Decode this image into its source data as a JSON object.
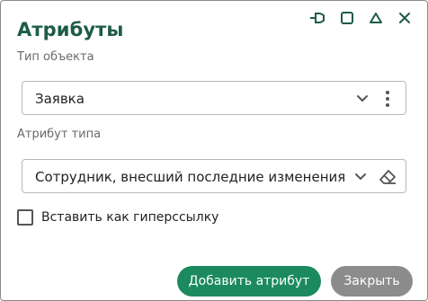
{
  "dialog": {
    "title": "Атрибуты",
    "controls": [
      "pin-icon",
      "maximize-icon",
      "collapse-icon",
      "close-icon"
    ]
  },
  "object_type": {
    "label": "Тип объекта",
    "value": "Заявка"
  },
  "type_attribute": {
    "label": "Атрибут типа",
    "value": "Сотрудник, внесший последние изменения"
  },
  "hyperlink_checkbox": {
    "label": "Вставить как гиперссылку",
    "checked": false
  },
  "buttons": {
    "add": "Добавить атрибут",
    "close": "Закрыть"
  },
  "colors": {
    "title": "#1d5c45",
    "primary_button": "#1b8a5e",
    "secondary_button": "#8c8c8c"
  }
}
